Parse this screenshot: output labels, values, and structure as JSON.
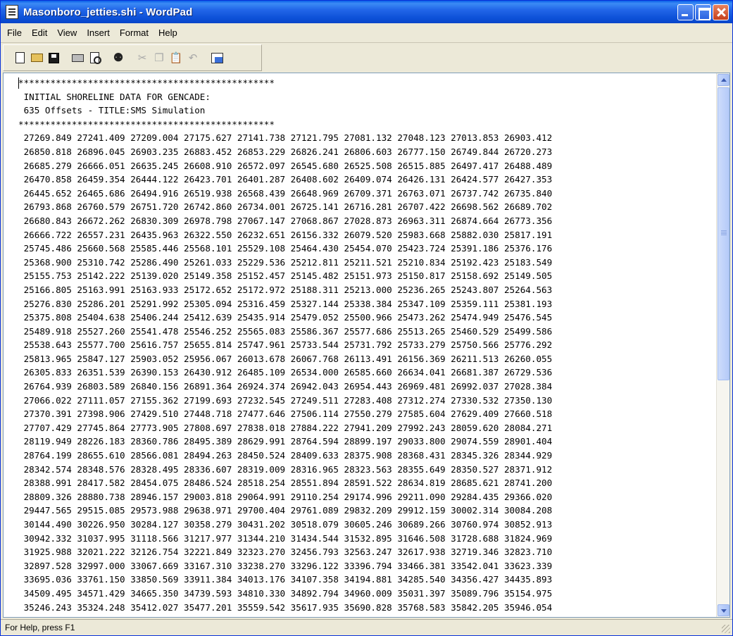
{
  "window": {
    "title": "Masonboro_jetties.shi - WordPad"
  },
  "menu": {
    "items": [
      "File",
      "Edit",
      "View",
      "Insert",
      "Format",
      "Help"
    ]
  },
  "toolbar": {
    "icons": [
      "new-icon",
      "open-icon",
      "save-icon",
      "print-icon",
      "print-preview-icon",
      "find-icon",
      "cut-icon",
      "copy-icon",
      "paste-icon",
      "undo-icon",
      "date-time-icon"
    ]
  },
  "document": {
    "header_lines": [
      "************************************************",
      " INITIAL SHORELINE DATA FOR GENCADE:",
      " 635 Offsets - TITLE:SMS Simulation",
      "************************************************"
    ],
    "rows": [
      [
        "27269.849",
        "27241.409",
        "27209.004",
        "27175.627",
        "27141.738",
        "27121.795",
        "27081.132",
        "27048.123",
        "27013.853",
        "26903.412"
      ],
      [
        "26850.818",
        "26896.045",
        "26903.235",
        "26883.452",
        "26853.229",
        "26826.241",
        "26806.603",
        "26777.150",
        "26749.844",
        "26720.273"
      ],
      [
        "26685.279",
        "26666.051",
        "26635.245",
        "26608.910",
        "26572.097",
        "26545.680",
        "26525.508",
        "26515.885",
        "26497.417",
        "26488.489"
      ],
      [
        "26470.858",
        "26459.354",
        "26444.122",
        "26423.701",
        "26401.287",
        "26408.602",
        "26409.074",
        "26426.131",
        "26424.577",
        "26427.353"
      ],
      [
        "26445.652",
        "26465.686",
        "26494.916",
        "26519.938",
        "26568.439",
        "26648.969",
        "26709.371",
        "26763.071",
        "26737.742",
        "26735.840"
      ],
      [
        "26793.868",
        "26760.579",
        "26751.720",
        "26742.860",
        "26734.001",
        "26725.141",
        "26716.281",
        "26707.422",
        "26698.562",
        "26689.702"
      ],
      [
        "26680.843",
        "26672.262",
        "26830.309",
        "26978.798",
        "27067.147",
        "27068.867",
        "27028.873",
        "26963.311",
        "26874.664",
        "26773.356"
      ],
      [
        "26666.722",
        "26557.231",
        "26435.963",
        "26322.550",
        "26232.651",
        "26156.332",
        "26079.520",
        "25983.668",
        "25882.030",
        "25817.191"
      ],
      [
        "25745.486",
        "25660.568",
        "25585.446",
        "25568.101",
        "25529.108",
        "25464.430",
        "25454.070",
        "25423.724",
        "25391.186",
        "25376.176"
      ],
      [
        "25368.900",
        "25310.742",
        "25286.490",
        "25261.033",
        "25229.536",
        "25212.811",
        "25211.521",
        "25210.834",
        "25192.423",
        "25183.549"
      ],
      [
        "25155.753",
        "25142.222",
        "25139.020",
        "25149.358",
        "25152.457",
        "25145.482",
        "25151.973",
        "25150.817",
        "25158.692",
        "25149.505"
      ],
      [
        "25166.805",
        "25163.991",
        "25163.933",
        "25172.652",
        "25172.972",
        "25188.311",
        "25213.000",
        "25236.265",
        "25243.807",
        "25264.563"
      ],
      [
        "25276.830",
        "25286.201",
        "25291.992",
        "25305.094",
        "25316.459",
        "25327.144",
        "25338.384",
        "25347.109",
        "25359.111",
        "25381.193"
      ],
      [
        "25375.808",
        "25404.638",
        "25406.244",
        "25412.639",
        "25435.914",
        "25479.052",
        "25500.966",
        "25473.262",
        "25474.949",
        "25476.545"
      ],
      [
        "25489.918",
        "25527.260",
        "25541.478",
        "25546.252",
        "25565.083",
        "25586.367",
        "25577.686",
        "25513.265",
        "25460.529",
        "25499.586"
      ],
      [
        "25538.643",
        "25577.700",
        "25616.757",
        "25655.814",
        "25747.961",
        "25733.544",
        "25731.792",
        "25733.279",
        "25750.566",
        "25776.292"
      ],
      [
        "25813.965",
        "25847.127",
        "25903.052",
        "25956.067",
        "26013.678",
        "26067.768",
        "26113.491",
        "26156.369",
        "26211.513",
        "26260.055"
      ],
      [
        "26305.833",
        "26351.539",
        "26390.153",
        "26430.912",
        "26485.109",
        "26534.000",
        "26585.660",
        "26634.041",
        "26681.387",
        "26729.536"
      ],
      [
        "26764.939",
        "26803.589",
        "26840.156",
        "26891.364",
        "26924.374",
        "26942.043",
        "26954.443",
        "26969.481",
        "26992.037",
        "27028.384"
      ],
      [
        "27066.022",
        "27111.057",
        "27155.362",
        "27199.693",
        "27232.545",
        "27249.511",
        "27283.408",
        "27312.274",
        "27330.532",
        "27350.130"
      ],
      [
        "27370.391",
        "27398.906",
        "27429.510",
        "27448.718",
        "27477.646",
        "27506.114",
        "27550.279",
        "27585.604",
        "27629.409",
        "27660.518"
      ],
      [
        "27707.429",
        "27745.864",
        "27773.905",
        "27808.697",
        "27838.018",
        "27884.222",
        "27941.209",
        "27992.243",
        "28059.620",
        "28084.271"
      ],
      [
        "28119.949",
        "28226.183",
        "28360.786",
        "28495.389",
        "28629.991",
        "28764.594",
        "28899.197",
        "29033.800",
        "29074.559",
        "28901.404"
      ],
      [
        "28764.199",
        "28655.610",
        "28566.081",
        "28494.263",
        "28450.524",
        "28409.633",
        "28375.908",
        "28368.431",
        "28345.326",
        "28344.929"
      ],
      [
        "28342.574",
        "28348.576",
        "28328.495",
        "28336.607",
        "28319.009",
        "28316.965",
        "28323.563",
        "28355.649",
        "28350.527",
        "28371.912"
      ],
      [
        "28388.991",
        "28417.582",
        "28454.075",
        "28486.524",
        "28518.254",
        "28551.894",
        "28591.522",
        "28634.819",
        "28685.621",
        "28741.200"
      ],
      [
        "28809.326",
        "28880.738",
        "28946.157",
        "29003.818",
        "29064.991",
        "29110.254",
        "29174.996",
        "29211.090",
        "29284.435",
        "29366.020"
      ],
      [
        "29447.565",
        "29515.085",
        "29573.988",
        "29638.971",
        "29700.404",
        "29761.089",
        "29832.209",
        "29912.159",
        "30002.314",
        "30084.208"
      ],
      [
        "30144.490",
        "30226.950",
        "30284.127",
        "30358.279",
        "30431.202",
        "30518.079",
        "30605.246",
        "30689.266",
        "30760.974",
        "30852.913"
      ],
      [
        "30942.332",
        "31037.995",
        "31118.566",
        "31217.977",
        "31344.210",
        "31434.544",
        "31532.895",
        "31646.508",
        "31728.688",
        "31824.969"
      ],
      [
        "31925.988",
        "32021.222",
        "32126.754",
        "32221.849",
        "32323.270",
        "32456.793",
        "32563.247",
        "32617.938",
        "32719.346",
        "32823.710"
      ],
      [
        "32897.528",
        "32997.000",
        "33067.669",
        "33167.310",
        "33238.270",
        "33296.122",
        "33396.794",
        "33466.381",
        "33542.041",
        "33623.339"
      ],
      [
        "33695.036",
        "33761.150",
        "33850.569",
        "33911.384",
        "34013.176",
        "34107.358",
        "34194.881",
        "34285.540",
        "34356.427",
        "34435.893"
      ],
      [
        "34509.495",
        "34571.429",
        "34665.350",
        "34739.593",
        "34810.330",
        "34892.794",
        "34960.009",
        "35031.397",
        "35089.796",
        "35154.975"
      ],
      [
        "35246.243",
        "35324.248",
        "35412.027",
        "35477.201",
        "35559.542",
        "35617.935",
        "35690.828",
        "35768.583",
        "35842.205",
        "35946.054"
      ]
    ]
  },
  "statusbar": {
    "text": "For Help, press F1"
  }
}
